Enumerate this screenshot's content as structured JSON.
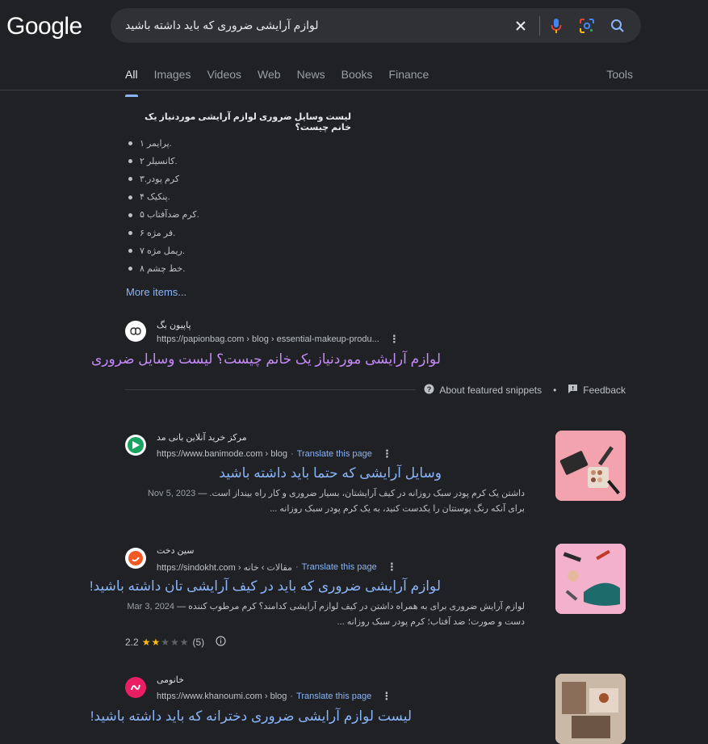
{
  "logo": "Google",
  "search": {
    "query": "لوازم آرایشی ضروری که باید داشته باشید"
  },
  "tabs": [
    "All",
    "Images",
    "Videos",
    "Web",
    "News",
    "Books",
    "Finance"
  ],
  "tools_label": "Tools",
  "featured_snippet": {
    "question": "لیست وسایل ضروری لوازم آرایشی موردنیاز یک خانم چیست؟",
    "items": [
      "پرایمر ۱.",
      "کانسیلر ۲.",
      "۳.کرم پودر",
      "پنکیک ۴.",
      "کرم ضدآفتاب ۵.",
      "فر مژه ۶.",
      "ریمل مژه ۷.",
      "خط چشم ۸."
    ],
    "more_items": "More items...",
    "source": {
      "site_name": "پاپیون بگ",
      "url": "https://papionbag.com › blog › essential-makeup-produ...",
      "title": "لوازم آرایشی موردنیاز یک خانم چیست؟ لیست وسایل ضروری"
    },
    "about_label": "About featured snippets",
    "separator": "•",
    "feedback_label": "Feedback"
  },
  "results": [
    {
      "site_name": "مرکز خرید آنلاین بانی مد",
      "url": "https://www.banimode.com › blog",
      "translate": "Translate this page",
      "title": "وسایل آرایشی که حتما باید داشته باشید",
      "date": "Nov 5, 2023",
      "desc_line1": "داشتن یک کرم پودر سبک روزانه در کیف آرایشتان، بسیار ضروری و کار راه بینداز است. —",
      "desc_line2": "برای آنکه رنگ پوستتان را یکدست کنید، به یک کرم پودر سبک روزانه ..."
    },
    {
      "site_name": "سین دخت",
      "url": "https://sindokht.com › مقالات › خانه",
      "translate": "Translate this page",
      "title": "لوازم آرایشی ضروری که باید در کیف آرایشی تان داشته باشید!",
      "date": "Mar 3, 2024",
      "desc_line1": "لوازم آرایش ضروری برای به همراه داشتن در کیف لوازم آرایشی کدامند؟ کرم مرطوب کننده —",
      "desc_line2": "دست و صورت؛ ضد آفتاب؛ کرم پودر سبک روزانه ...",
      "rating": "2.2",
      "reviews": "(5)"
    },
    {
      "site_name": "خانومی",
      "url": "https://www.khanoumi.com › blog",
      "translate": "Translate this page",
      "title": "لیست لوازم آرایشی ضروری دخترانه که باید داشته باشید!"
    }
  ]
}
